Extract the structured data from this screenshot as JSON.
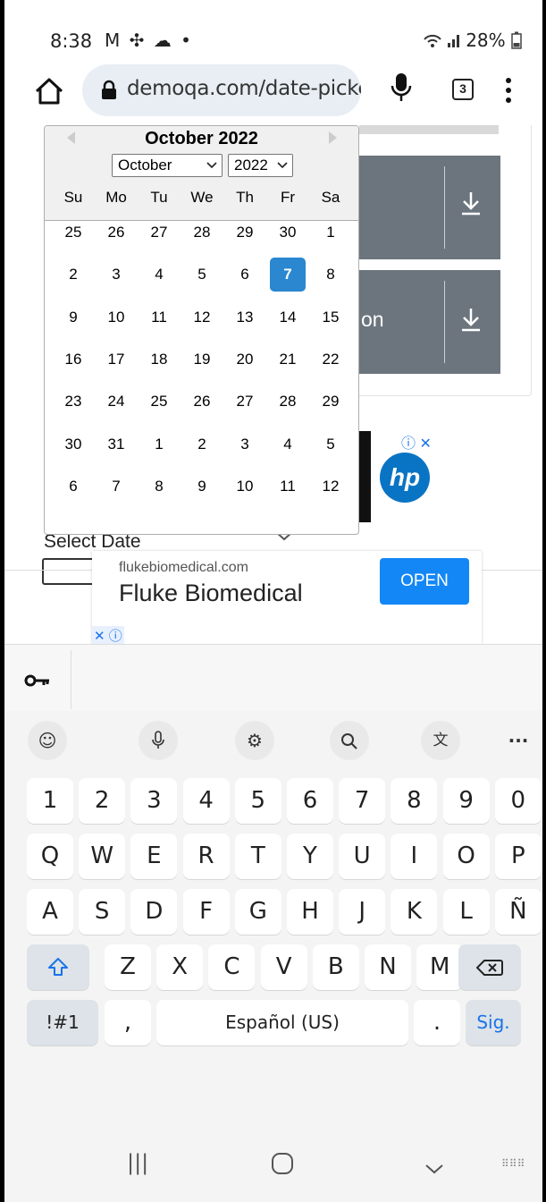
{
  "status_bar": {
    "time": "8:38",
    "left_icons": "M ✣ ☁ •",
    "battery": "28%"
  },
  "browser": {
    "url": "demoqa.com/date-picker",
    "tab_count": "3"
  },
  "page": {
    "select_date_label": "Select Date",
    "button_partial_text": "on"
  },
  "calendar": {
    "title": "October 2022",
    "month_select": "October",
    "year_select": "2022",
    "weekdays": [
      "Su",
      "Mo",
      "Tu",
      "We",
      "Th",
      "Fr",
      "Sa"
    ],
    "weeks": [
      [
        "25",
        "26",
        "27",
        "28",
        "29",
        "30",
        "1"
      ],
      [
        "2",
        "3",
        "4",
        "5",
        "6",
        "7",
        "8"
      ],
      [
        "9",
        "10",
        "11",
        "12",
        "13",
        "14",
        "15"
      ],
      [
        "16",
        "17",
        "18",
        "19",
        "20",
        "21",
        "22"
      ],
      [
        "23",
        "24",
        "25",
        "26",
        "27",
        "28",
        "29"
      ],
      [
        "30",
        "31",
        "1",
        "2",
        "3",
        "4",
        "5"
      ],
      [
        "6",
        "7",
        "8",
        "9",
        "10",
        "11",
        "12"
      ]
    ],
    "selected_day": "7"
  },
  "ad": {
    "domain": "flukebiomedical.com",
    "title": "Fluke Biomedical",
    "cta": "OPEN",
    "brand_logo": "hp"
  },
  "keyboard": {
    "row_numbers": [
      "1",
      "2",
      "3",
      "4",
      "5",
      "6",
      "7",
      "8",
      "9",
      "0"
    ],
    "row_1": [
      "Q",
      "W",
      "E",
      "R",
      "T",
      "Y",
      "U",
      "I",
      "O",
      "P"
    ],
    "row_2": [
      "A",
      "S",
      "D",
      "F",
      "G",
      "H",
      "J",
      "K",
      "L",
      "Ñ"
    ],
    "row_3": [
      "Z",
      "X",
      "C",
      "V",
      "B",
      "N",
      "M"
    ],
    "symbols_key": "!#1",
    "comma_key": ",",
    "space_label": "Español (US)",
    "period_key": ".",
    "action_key": "Sig."
  }
}
